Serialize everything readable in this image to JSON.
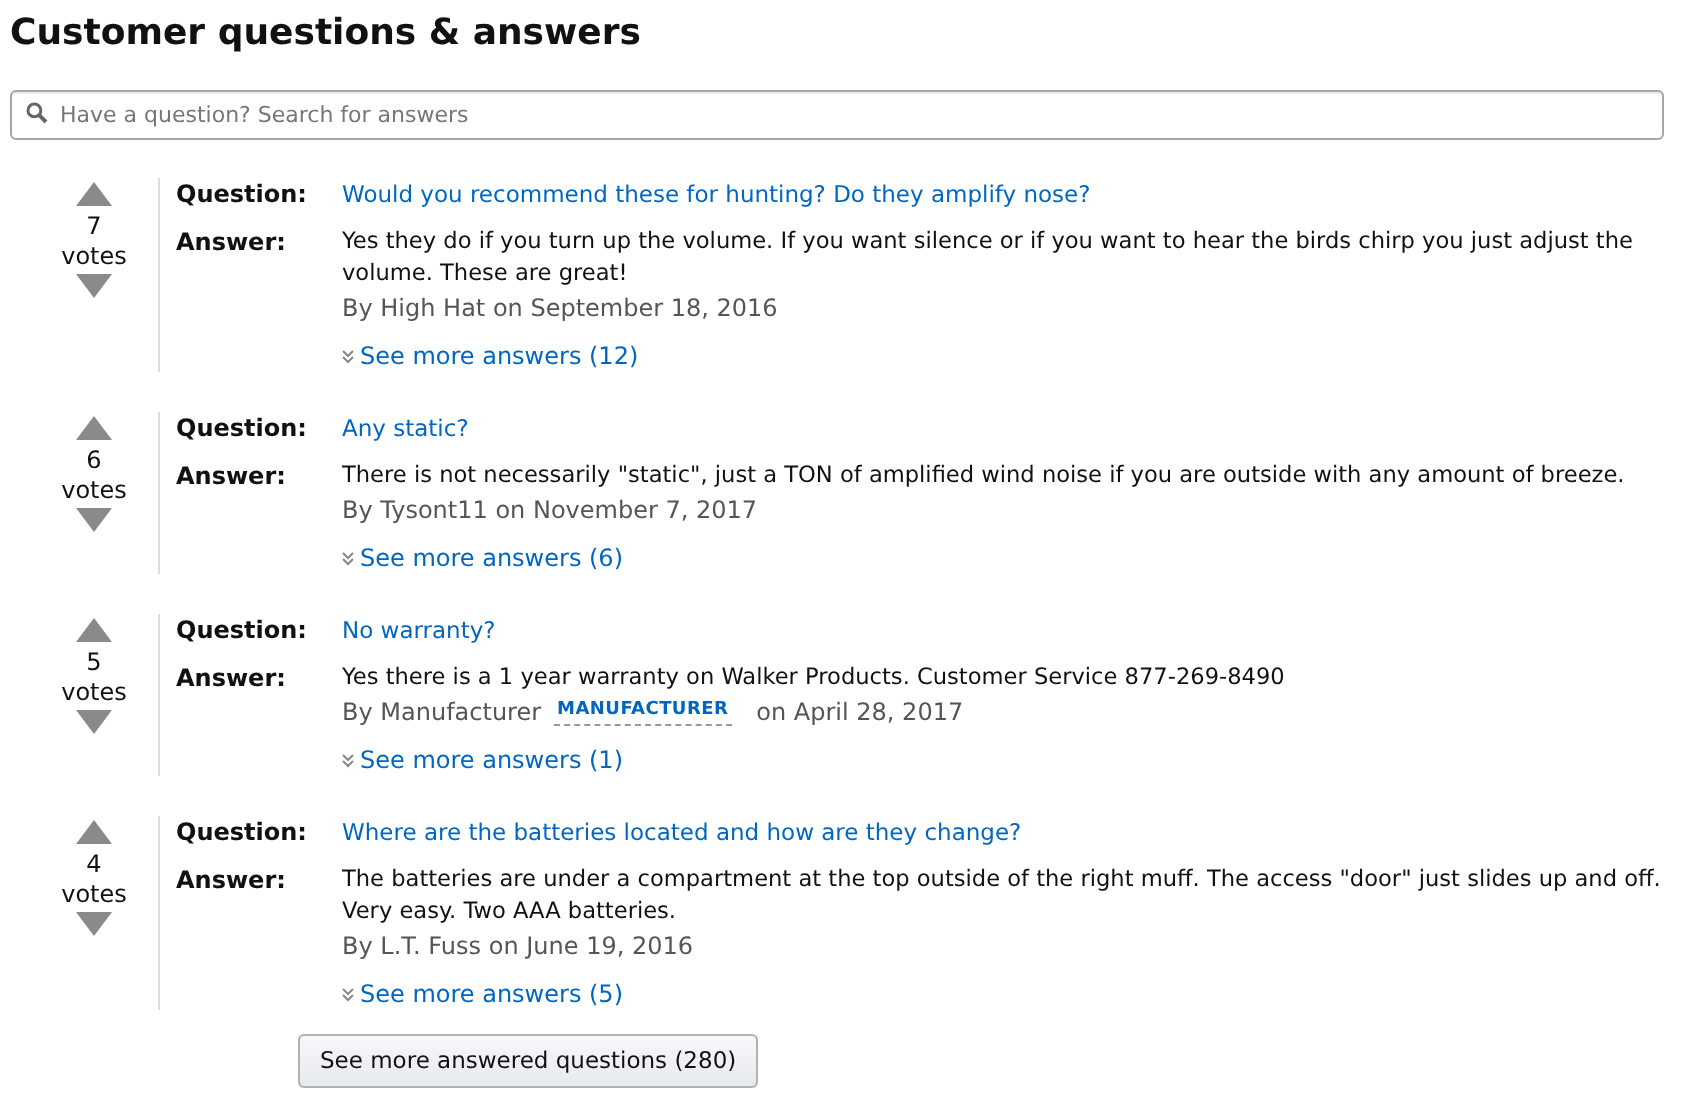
{
  "title": "Customer questions & answers",
  "search": {
    "placeholder": "Have a question? Search for answers"
  },
  "questions": [
    {
      "vote_count": "7",
      "vote_label": "votes",
      "question_label": "Question:",
      "question": "Would you recommend these for hunting? Do they amplify nose?",
      "answer_label": "Answer:",
      "answer": "Yes they do if you turn up the volume. If you want silence or if you want to hear the birds chirp you just adjust the volume. These are great!",
      "byline": "By High Hat on September 18, 2016",
      "more": "See more answers (12)"
    },
    {
      "vote_count": "6",
      "vote_label": "votes",
      "question_label": "Question:",
      "question": "Any static?",
      "answer_label": "Answer:",
      "answer": "There is not necessarily \"static\", just a TON of amplified wind noise if you are outside with any amount of breeze.",
      "byline": "By Tysont11 on November 7, 2017",
      "more": "See more answers (6)"
    },
    {
      "vote_count": "5",
      "vote_label": "votes",
      "question_label": "Question:",
      "question": "No warranty?",
      "answer_label": "Answer:",
      "answer": "Yes there is a 1 year warranty on Walker Products. Customer Service 877-269-8490",
      "byline": "By Manufacturer",
      "badge": "MANUFACTURER",
      "byline_after": "on April 28, 2017",
      "more": "See more answers (1)"
    },
    {
      "vote_count": "4",
      "vote_label": "votes",
      "question_label": "Question:",
      "question": "Where are the batteries located and how are they change?",
      "answer_label": "Answer:",
      "answer": "The batteries are under a compartment at the top outside of the right muff. The access \"door\" just slides up and off. Very easy. Two AAA batteries.",
      "byline": "By L.T. Fuss on June 19, 2016",
      "more": "See more answers (5)"
    }
  ],
  "more_button": "See more answered questions (280)"
}
